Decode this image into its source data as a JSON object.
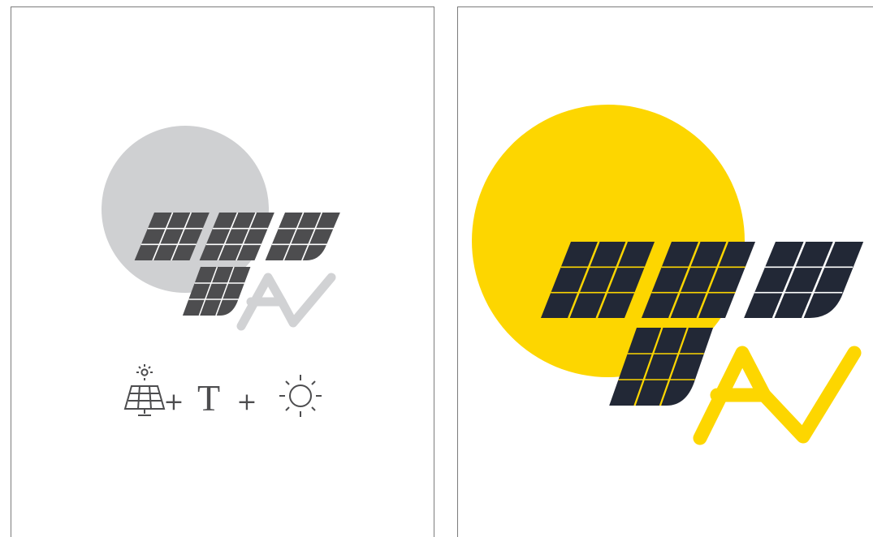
{
  "colors": {
    "page_background": "#ffffff",
    "board_border": "#7c7c7c",
    "mono_sun": "#cfd0d2",
    "mono_panel": "#4d4d4f",
    "mono_av_letters": "#d1d2d4",
    "color_sun": "#fdd600",
    "color_panel": "#222836",
    "color_av_letters": "#fdd600",
    "formula_ink": "#4d4d4f"
  },
  "left_board": {
    "logo_variant": "monochrome",
    "formula": {
      "plus_1": "+",
      "letter": "T",
      "plus_2": "+",
      "icons": [
        "solar-panel-with-sun-icon",
        "sun-outline-icon"
      ]
    }
  },
  "right_board": {
    "logo_variant": "color"
  }
}
